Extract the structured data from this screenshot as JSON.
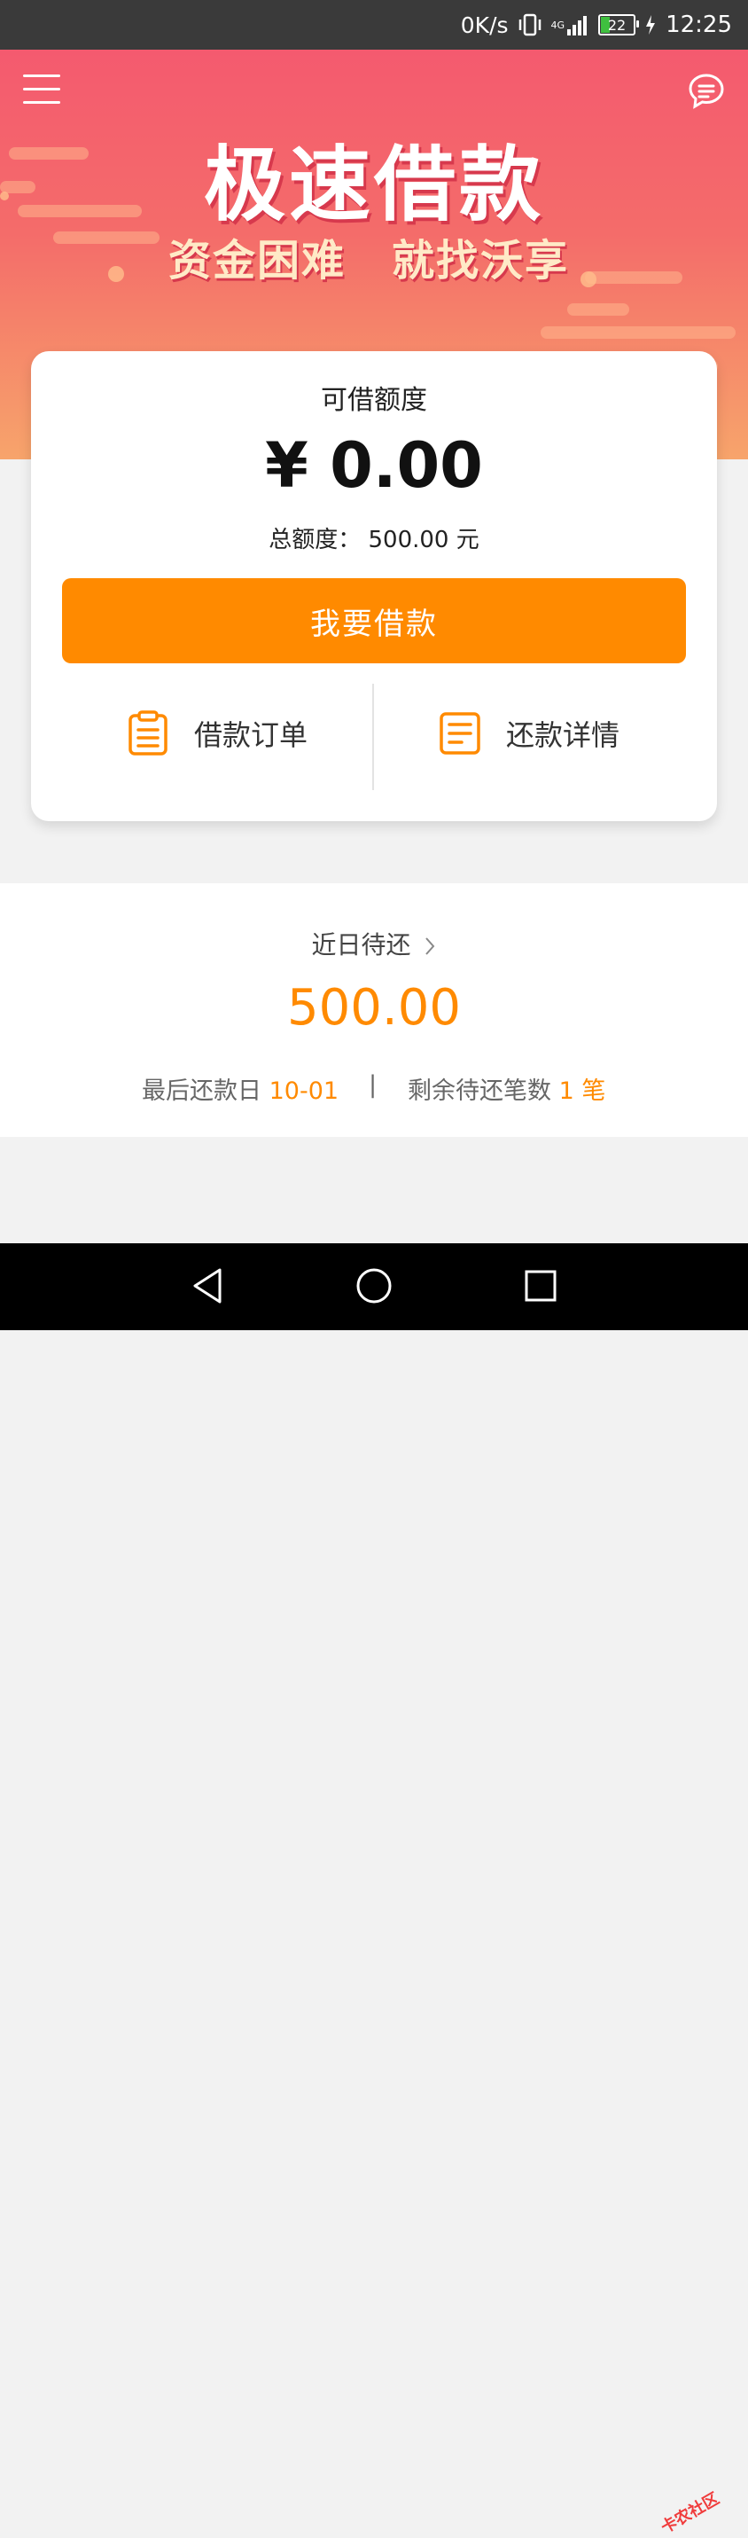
{
  "status_bar": {
    "net_speed": "0K/s",
    "network": "4G",
    "battery": "22",
    "time": "12:25"
  },
  "banner": {
    "title": "极速借款",
    "sub_left": "资金困难",
    "sub_right": "就找沃享",
    "accent": "#f45a6f"
  },
  "card": {
    "label": "可借额度",
    "amount": "¥ 0.00",
    "total": "总额度： 500.00 元",
    "borrow_button": "我要借款",
    "borrow_color": "#ff8a00",
    "action_orders": "借款订单",
    "action_repay": "还款详情"
  },
  "pending": {
    "title": "近日待还",
    "amount": "500.00",
    "last_date_label": "最后还款日",
    "last_date": "10-01",
    "separator": "|",
    "remaining_label": "剩余待还笔数",
    "remaining_count": "1",
    "remaining_unit": "笔"
  },
  "watermark": "卡农社区"
}
